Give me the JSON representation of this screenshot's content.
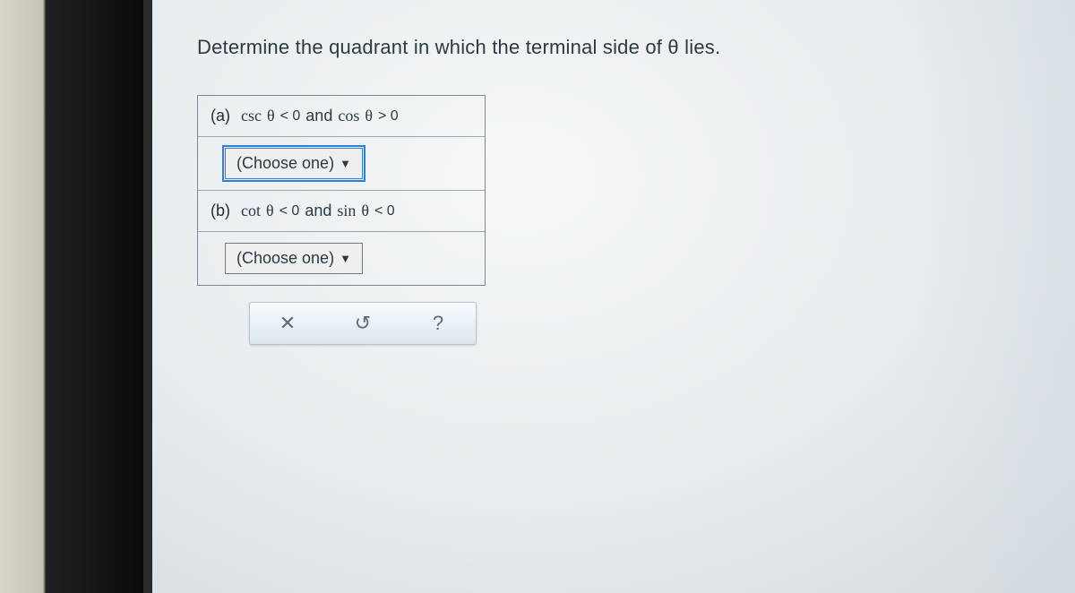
{
  "question": "Determine the quadrant in which the terminal side of θ lies.",
  "parts": [
    {
      "label": "(a)",
      "condition": {
        "f1": "csc",
        "rel1": "< 0",
        "conj": "and",
        "f2": "cos",
        "rel2": "> 0"
      },
      "dropdown": {
        "text": "(Choose one)",
        "focused": true
      }
    },
    {
      "label": "(b)",
      "condition": {
        "f1": "cot",
        "rel1": "< 0",
        "conj": "and",
        "f2": "sin",
        "rel2": "< 0"
      },
      "dropdown": {
        "text": "(Choose one)",
        "focused": false
      }
    }
  ],
  "toolbar": {
    "clear": "✕",
    "reset": "↺",
    "help": "?"
  },
  "theta": "θ"
}
